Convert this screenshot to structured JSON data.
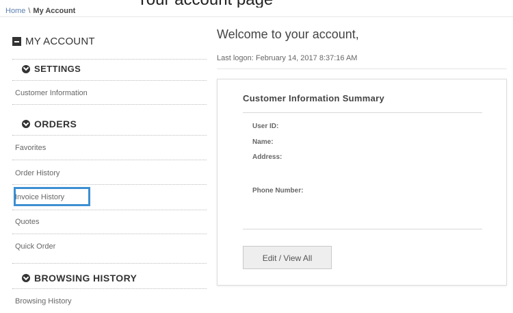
{
  "header": {
    "cut_off_text": "Your account page"
  },
  "breadcrumb": {
    "home": "Home",
    "separator": "\\",
    "current": "My Account"
  },
  "sidebar": {
    "title": "MY ACCOUNT",
    "sections": {
      "settings": {
        "label": "SETTINGS",
        "items": [
          "Customer Information"
        ]
      },
      "orders": {
        "label": "ORDERS",
        "items": [
          "Favorites",
          "Order History",
          "Invoice History",
          "Quotes",
          "Quick Order"
        ]
      },
      "browsing": {
        "label": "BROWSING HISTORY",
        "items": [
          "Browsing History"
        ]
      }
    },
    "highlighted_item": "Invoice History",
    "highlight_color": "#3c8fd3"
  },
  "main": {
    "welcome": "Welcome to your account,",
    "last_logon": "Last logon: February 14, 2017 8:37:16 AM",
    "card": {
      "title": "Customer Information Summary",
      "fields": {
        "user_id": "User ID:",
        "name": "Name:",
        "address": "Address:",
        "phone": "Phone Number:"
      },
      "button_label": "Edit / View All"
    }
  },
  "icons": {
    "account": "square-minus-icon",
    "section": "circle-chevron-down-icon"
  }
}
